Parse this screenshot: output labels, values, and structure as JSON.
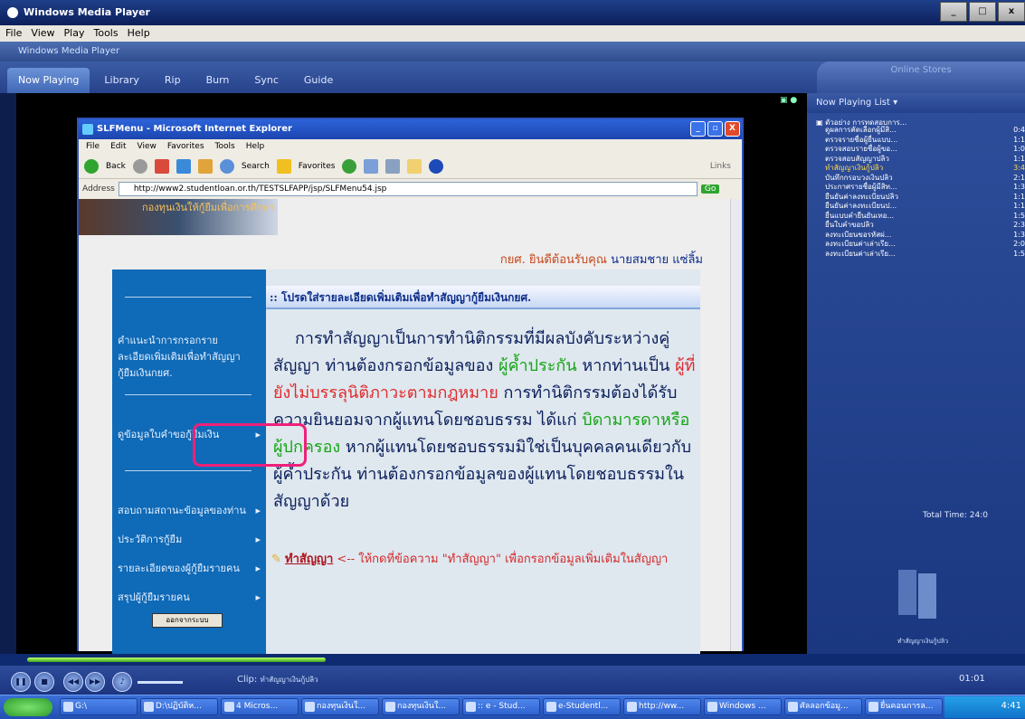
{
  "window": {
    "title": "Windows Media Player",
    "menu": [
      "File",
      "View",
      "Play",
      "Tools",
      "Help"
    ],
    "inner_title": "Windows Media Player"
  },
  "tabs": [
    "Now Playing",
    "Library",
    "Rip",
    "Burn",
    "Sync",
    "Guide"
  ],
  "online_stores": "Online Stores",
  "browser": {
    "title": "SLFMenu - Microsoft Internet Explorer",
    "menu": [
      "File",
      "Edit",
      "View",
      "Favorites",
      "Tools",
      "Help"
    ],
    "toolbar": {
      "back": "Back",
      "search": "Search",
      "favorites": "Favorites",
      "links": "Links"
    },
    "address_label": "Address",
    "address": "http://www2.studentloan.or.th/TESTSLFAPP/jsp/SLFMenu54.jsp",
    "go": "Go"
  },
  "page": {
    "banner": "กองทุนเงินให้กู้ยืมเพื่อการศึกษา",
    "greeting_prefix": "กยศ. ยินดีต้อนรับคุณ",
    "greeting_name": "นายสมชาย แซ่ลิ้ม",
    "header": ":: โปรดใส่รายละเอียดเพิ่มเติมเพื่อทำสัญญากู้ยืมเงินกยศ.",
    "sidebar": [
      "คำแนะนำการกรอกรายละเอียดเพิ่มเติมเพื่อทำสัญญากู้ยืมเงินกยศ.",
      "ดูข้อมูลใบคำขอกู้ยืมเงิน",
      "สอบถามสถานะข้อมูลของท่าน",
      "ประวัติการกู้ยืม",
      "รายละเอียดของผู้กู้ยืมรายคน",
      "สรุปผู้กู้ยืมรายคน"
    ],
    "exit_button": "ออกจากระบบ",
    "p1": "การทำสัญญาเป็นการทำนิติกรรมที่มีผลบังคับระหว่างคู่สัญญา ท่านต้องกรอกข้อมูลของ ",
    "p_green1": "ผู้ค้ำประกัน",
    "p2": " หากท่านเป็น ",
    "p_red1": "ผู้ที่ยังไม่บรรลุนิติภาวะตามกฎหมาย",
    "p3": " การทำนิติกรรมต้องได้รับความยินยอมจากผู้แทนโดยชอบธรรม ได้แก่ ",
    "p_green2": "บิดามารดาหรือผู้ปกครอง",
    "p4": " หากผู้แทนโดยชอบธรรมมิใช่เป็นบุคคลคนเดียวกับผู้ค้ำประกัน ท่านต้องกรอกข้อมูลของผู้แทนโดยชอบธรรมในสัญญาด้วย",
    "action_link": "ทำสัญญา",
    "action_text": " <-- ให้กดที่ข้อความ \"ทำสัญญา\" เพื่อกรอกข้อมูลเพิ่มเติมในสัญญา"
  },
  "playlist": {
    "header": "Now Playing List",
    "group": "ตัวอย่าง การทดสอบการ...",
    "items": [
      {
        "title": "ดูผลการคัดเลือกผู้มีสิ...",
        "time": "0:4"
      },
      {
        "title": "ตรวจรายชื่อผู้ยื่นแบบ...",
        "time": "1:1"
      },
      {
        "title": "ตรวจสอบรายชื่อผู้ขอ...",
        "time": "1:0"
      },
      {
        "title": "ตรวจสอบสัญญาปลิว",
        "time": "1:1"
      },
      {
        "title": "ทำสัญญาเงินกู้ปลิว",
        "time": "3:4"
      },
      {
        "title": "บันทึกกรอบวงเงินปลิว",
        "time": "2:1"
      },
      {
        "title": "ประกาศรายชื่อผู้มีสิท...",
        "time": "1:3"
      },
      {
        "title": "ยืนยันค่าลงทะเบียนปลิว",
        "time": "1:1"
      },
      {
        "title": "ยืนยันค่าลงทะเบียนป...",
        "time": "1:1"
      },
      {
        "title": "ยื่นแบบคำยืนยันเทอ...",
        "time": "1:5"
      },
      {
        "title": "ยื่นใบคำขอปลิว",
        "time": "2:3"
      },
      {
        "title": "ลงทะเบียนขอรหัสผ่...",
        "time": "1:3"
      },
      {
        "title": "ลงทะเบียนค่าเล่าเรีย...",
        "time": "2:0"
      },
      {
        "title": "ลงทะเบียนค่าเล่าเรีย...",
        "time": "1:5"
      }
    ],
    "current_index": 4,
    "total_time": "Total Time: 24:0",
    "thumb_caption": "ทำสัญญาเงินกู้ปลิว"
  },
  "player": {
    "clip_label": "Clip:",
    "clip_name": "ทำสัญญาเงินกู้ปลิว",
    "time": "01:01",
    "progress": 0.3
  },
  "taskbar": {
    "buttons": [
      "G:\\",
      "D:\\ปฏิบัติห...",
      "4 Micros...",
      "กองทุนเงินใ...",
      "กองทุนเงินใ...",
      ":: e - Stud...",
      "e-Studentl...",
      "http://ww...",
      "Windows ...",
      "ศัลลอกข้อมู...",
      "ยื่นคอนการล..."
    ],
    "clock": "4:41"
  }
}
